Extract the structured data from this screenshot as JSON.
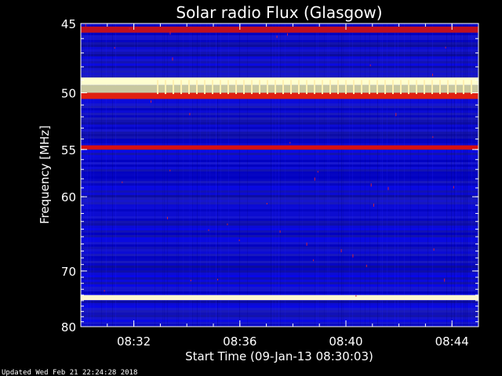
{
  "chart_data": {
    "type": "heatmap",
    "title": "Solar radio Flux (Glasgow)",
    "xlabel": "Start Time (09-Jan-13 08:30:03)",
    "ylabel": "Frequency [MHz]",
    "x_ticks": [
      "08:32",
      "08:36",
      "08:40",
      "08:44"
    ],
    "x_tick_minutes": [
      2,
      6,
      10,
      14
    ],
    "xlim_minutes": [
      0,
      15
    ],
    "y_ticks": [
      45,
      50,
      55,
      60,
      70,
      80
    ],
    "ylim": [
      45,
      80
    ],
    "y_scale": "reciprocal",
    "background_color": "#1010c8",
    "bands": [
      {
        "freq": [
          45.2,
          45.6
        ],
        "color": "#c01020"
      },
      {
        "freq": [
          48.8,
          49.4
        ],
        "color": "#ffffd0"
      },
      {
        "freq": [
          49.4,
          50.0
        ],
        "color": "#c8c8a0"
      },
      {
        "freq": [
          50.0,
          50.5
        ],
        "color": "#e02010"
      },
      {
        "freq": [
          54.6,
          55.0
        ],
        "color": "#d81010"
      },
      {
        "freq": [
          74.0,
          74.9
        ],
        "color": "#fff8d0"
      }
    ],
    "footer": "Updated Wed Feb 21 22:24:28 2018"
  }
}
